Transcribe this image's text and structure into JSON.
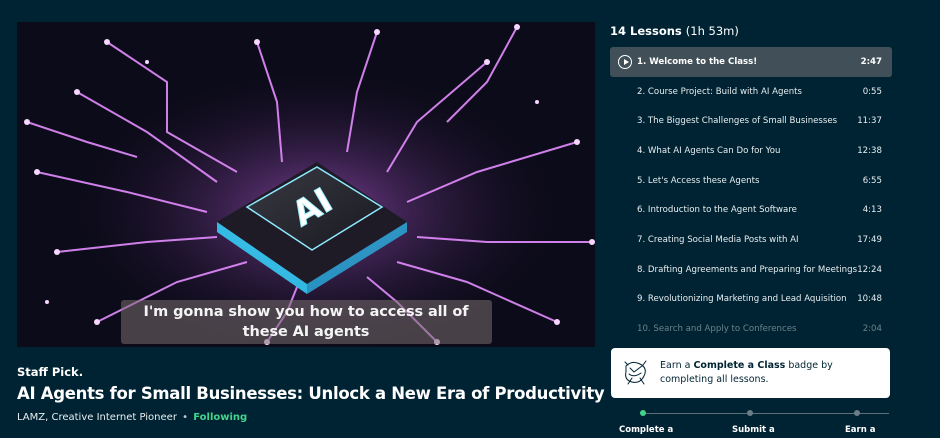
{
  "video": {
    "caption": "I'm gonna show you how to access all of these AI agents",
    "chip_label": "AI"
  },
  "course": {
    "staff_pick": "Staff Pick.",
    "title": "AI Agents for Small Businesses: Unlock a New Era of Productivity",
    "author": "LAMZ, Creative Internet Pioneer",
    "separator": "•",
    "follow_status": "Following"
  },
  "lessons_panel": {
    "count_label": "14 Lessons",
    "total_duration": "(1h 53m)",
    "items": [
      {
        "title": "1. Welcome to the Class!",
        "duration": "2:47"
      },
      {
        "title": "2. Course Project: Build with AI Agents",
        "duration": "0:55"
      },
      {
        "title": "3. The Biggest Challenges of Small Businesses",
        "duration": "11:37"
      },
      {
        "title": "4. What AI Agents Can Do for You",
        "duration": "12:38"
      },
      {
        "title": "5. Let's Access these Agents",
        "duration": "6:55"
      },
      {
        "title": "6. Introduction to the Agent Software",
        "duration": "4:13"
      },
      {
        "title": "7. Creating Social Media Posts with AI",
        "duration": "17:49"
      },
      {
        "title": "8. Drafting Agreements and Preparing for Meetings",
        "duration": "12:24"
      },
      {
        "title": "9. Revolutionizing Marketing and Lead Aquisition",
        "duration": "10:48"
      },
      {
        "title": "10. Search and Apply to Conferences",
        "duration": "2:04"
      }
    ]
  },
  "badge": {
    "text_before": "Earn a ",
    "badge_name": "Complete a Class",
    "text_after": " badge by completing all lessons."
  },
  "progress_steps": [
    {
      "label": "Complete a"
    },
    {
      "label": "Submit a"
    },
    {
      "label": "Earn a"
    }
  ],
  "colors": {
    "background": "#002333",
    "accent_green": "#43d38a",
    "active_row": "#415058"
  }
}
